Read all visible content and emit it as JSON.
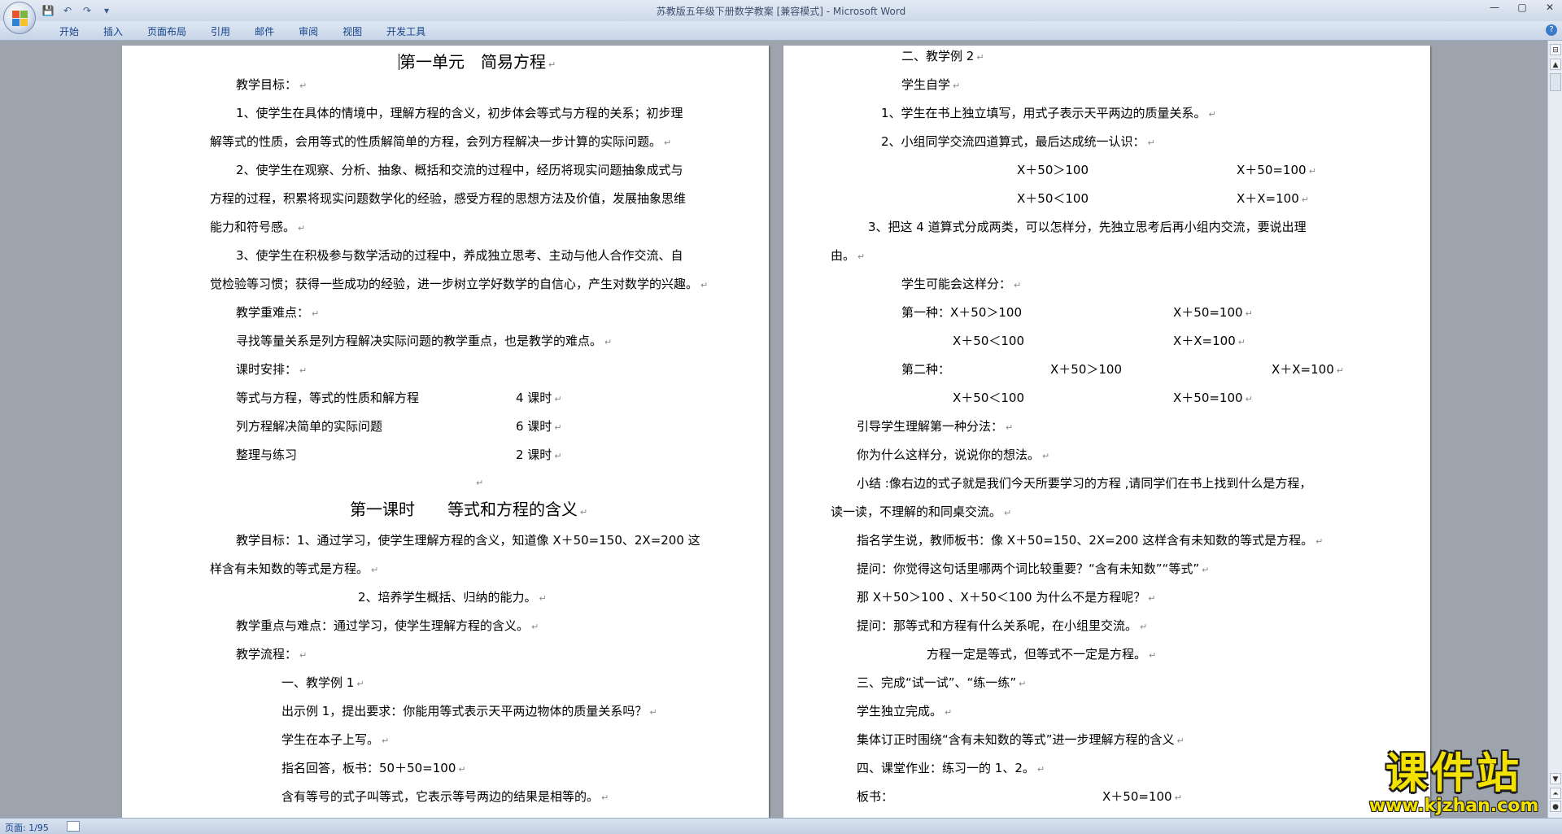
{
  "window": {
    "title": "苏教版五年级下册数学教案 [兼容模式] - Microsoft Word",
    "controls": [
      "—",
      "▢",
      "✕"
    ]
  },
  "ribbon": {
    "tabs": [
      "开始",
      "插入",
      "页面布局",
      "引用",
      "邮件",
      "审阅",
      "视图",
      "开发工具"
    ],
    "help": "?"
  },
  "left_page": {
    "lines": [
      "第一单元　简易方程",
      "教学目标：",
      "1、使学生在具体的情境中，理解方程的含义，初步体会等式与方程的关系；初步理",
      "解等式的性质，会用等式的性质解简单的方程，会列方程解决一步计算的实际问题。",
      "2、使学生在观察、分析、抽象、概括和交流的过程中，经历将现实问题抽象成式与",
      "方程的过程，积累将现实问题数学化的经验，感受方程的思想方法及价值，发展抽象思维",
      "能力和符号感。",
      "3、使学生在积极参与数学活动的过程中，养成独立思考、主动与他人合作交流、自",
      "觉检验等习惯；获得一些成功的经验，进一步树立学好数学的自信心，产生对数学的兴趣。",
      "教学重难点：",
      "寻找等量关系是列方程解决实际问题的教学重点，也是教学的难点。",
      "课时安排：",
      "等式与方程，等式的性质和解方程",
      "4 课时",
      "列方程解决简单的实际问题",
      "6 课时",
      "整理与练习",
      "2 课时",
      "第一课时　　等式和方程的含义",
      "教学目标：1、通过学习，使学生理解方程的含义，知道像 X＋50=150、2X=200 这",
      "样含有未知数的等式是方程。",
      "2、培养学生概括、归纳的能力。",
      "教学重点与难点：通过学习，使学生理解方程的含义。",
      "教学流程：",
      "一、教学例 1",
      "出示例 1，提出要求：你能用等式表示天平两边物体的质量关系吗？",
      "学生在本子上写。",
      "指名回答，板书：50＋50=100",
      "含有等号的式子叫等式，它表示等号两边的结果是相等的。"
    ]
  },
  "right_page": {
    "lines": [
      "二、教学例 2",
      "学生自学",
      "1、学生在书上独立填写，用式子表示天平两边的质量关系。",
      "2、小组同学交流四道算式，最后达成统一认识：",
      "X＋50＞100",
      "X＋50=100",
      "X＋50＜100",
      "X＋X=100",
      "3、把这 4 道算式分成两类，可以怎样分，先独立思考后再小组内交流，要说出理",
      "由。",
      "学生可能会这样分：",
      "第一种：X＋50＞100",
      "X＋50=100",
      "X＋50＜100",
      "X＋X=100",
      "第二种：",
      "X＋50＞100",
      "X＋X=100",
      "X＋50＜100",
      "X＋50=100",
      "引导学生理解第一种分法：",
      "你为什么这样分，说说你的想法。",
      "小结 :像右边的式子就是我们今天所要学习的方程 ,请同学们在书上找到什么是方程，",
      "读一读，不理解的和同桌交流。",
      "指名学生说，教师板书：像 X＋50=150、2X=200 这样含有未知数的等式是方程。",
      "提问：你觉得这句话里哪两个词比较重要？“含有未知数”“等式”",
      "那 X＋50＞100 、X＋50＜100 为什么不是方程呢？",
      "提问：那等式和方程有什么关系呢，在小组里交流。",
      "方程一定是等式，但等式不一定是方程。",
      "三、完成“试一试”、“练一练”",
      "学生独立完成。",
      "集体订正时围绕“含有未知数的等式”进一步理解方程的含义",
      "四、课堂作业：练习一的 1、2。",
      "板书：",
      "X＋50=100"
    ]
  },
  "status": {
    "page": "页面: 1/95"
  },
  "watermark": {
    "name": "课件站",
    "url": "www.kjzhan.com"
  },
  "colors": {
    "title_text": "#3e4f6e",
    "tab_text": "#15428b",
    "workspace": "#9ea4ad",
    "watermark_fill": "#f3e200"
  }
}
